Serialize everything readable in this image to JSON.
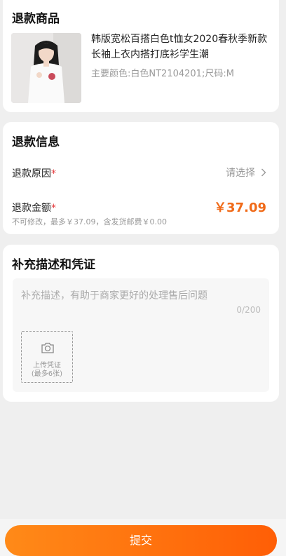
{
  "product_section": {
    "title": "退款商品",
    "name": "韩版宽松百搭白色t恤女2020春秋季新款长袖上衣内搭打底衫学生潮",
    "spec": "主要颜色:白色NT2104201;尺码:M"
  },
  "refund_section": {
    "title": "退款信息",
    "reason_label": "退款原因",
    "required_mark": "*",
    "reason_placeholder": "请选择",
    "amount_label": "退款金额",
    "amount_value": "￥37.09",
    "amount_note": "不可修改，最多￥37.09，含发货邮费￥0.00"
  },
  "desc_section": {
    "title": "补充描述和凭证",
    "placeholder": "补充描述，有助于商家更好的处理售后问题",
    "char_count": "0/200",
    "upload_label": "上传凭证",
    "upload_limit": "(最多6张)"
  },
  "submit_label": "提交",
  "colors": {
    "accent": "#f06a18",
    "button_start": "#ff8a18",
    "button_end": "#ff5e06"
  }
}
